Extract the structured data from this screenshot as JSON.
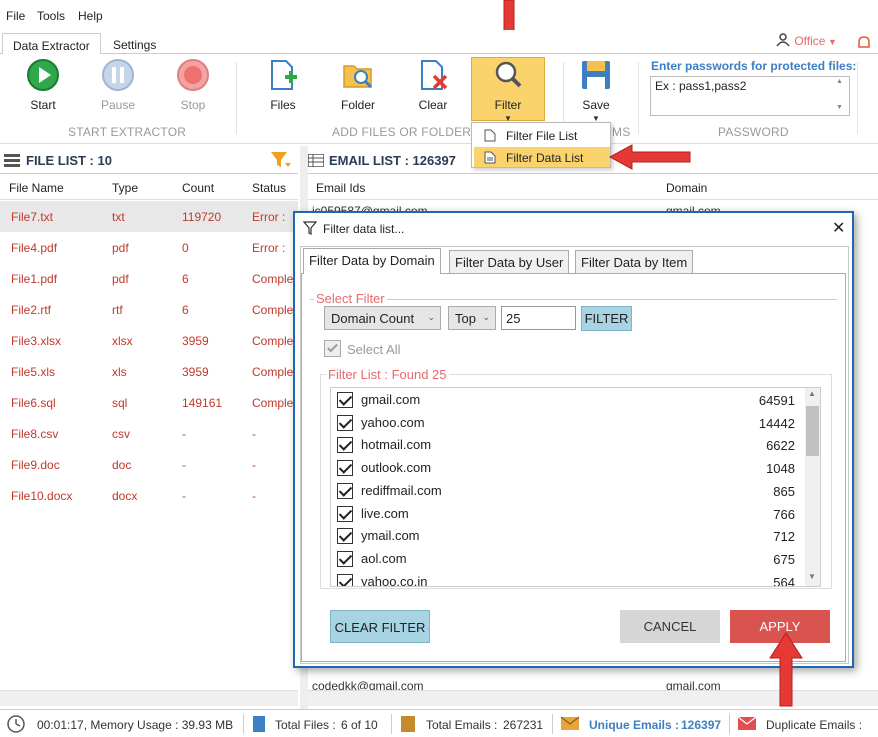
{
  "menu": {
    "file": "File",
    "tools": "Tools",
    "help": "Help"
  },
  "tabs": {
    "extractor": "Data Extractor",
    "settings": "Settings"
  },
  "office": "Office",
  "ribbon": {
    "start": "Start",
    "pause": "Pause",
    "stop": "Stop",
    "files": "Files",
    "folder": "Folder",
    "clear": "Clear",
    "filter": "Filter",
    "save": "Save",
    "grp_start": "START EXTRACTOR",
    "grp_add": "ADD FILES OR FOLDERS",
    "grp_ms": "MS",
    "grp_pw": "PASSWORD",
    "pw_label": "Enter passwords for protected files:",
    "pw_value": "Ex : pass1,pass2"
  },
  "dropdown": {
    "file_list": "Filter File List",
    "data_list": "Filter Data List"
  },
  "file_list": {
    "title": "FILE LIST : 10",
    "headers": [
      "File Name",
      "Type",
      "Count",
      "Status"
    ],
    "rows": [
      [
        "File7.txt",
        "txt",
        "119720",
        "Error :"
      ],
      [
        "File4.pdf",
        "pdf",
        "0",
        "Error :"
      ],
      [
        "File1.pdf",
        "pdf",
        "6",
        "Comple"
      ],
      [
        "File2.rtf",
        "rtf",
        "6",
        "Comple"
      ],
      [
        "File3.xlsx",
        "xlsx",
        "3959",
        "Comple"
      ],
      [
        "File5.xls",
        "xls",
        "3959",
        "Comple"
      ],
      [
        "File6.sql",
        "sql",
        "149161",
        "Comple"
      ],
      [
        "File8.csv",
        "csv",
        "-",
        "-"
      ],
      [
        "File9.doc",
        "doc",
        "-",
        "-"
      ],
      [
        "File10.docx",
        "docx",
        "-",
        "-"
      ]
    ]
  },
  "email_list": {
    "title": "EMAIL LIST : 126397",
    "headers": [
      "Email Ids",
      "Domain"
    ],
    "top_row": [
      "jc059587@gmail.com",
      "gmail.com"
    ],
    "bottom_row": [
      "codedkk@gmail.com",
      "gmail.com"
    ]
  },
  "dialog": {
    "title": "Filter data list...",
    "tabs": [
      "Filter Data by Domain",
      "Filter Data by User",
      "Filter Data by Item"
    ],
    "select_filter": "Select Filter",
    "sort_by": "Domain Count",
    "order": "Top",
    "count": "25",
    "filter_btn": "FILTER",
    "select_all": "Select All",
    "found": "Filter List : Found 25",
    "items": [
      {
        "name": "gmail.com",
        "count": "64591"
      },
      {
        "name": "yahoo.com",
        "count": "14442"
      },
      {
        "name": "hotmail.com",
        "count": "6622"
      },
      {
        "name": "outlook.com",
        "count": "1048"
      },
      {
        "name": "rediffmail.com",
        "count": "865"
      },
      {
        "name": "live.com",
        "count": "766"
      },
      {
        "name": "ymail.com",
        "count": "712"
      },
      {
        "name": "aol.com",
        "count": "675"
      },
      {
        "name": "yahoo.co.in",
        "count": "564"
      }
    ],
    "clear_btn": "CLEAR FILTER",
    "cancel_btn": "CANCEL",
    "apply_btn": "APPLY"
  },
  "status": {
    "time": "00:01:17, Memory Usage : 39.93 MB",
    "total_files_label": "Total Files :",
    "total_files": "6 of 10",
    "total_emails_label": "Total Emails :",
    "total_emails": "267231",
    "unique_label": "Unique Emails :",
    "unique": "126397",
    "dup_label": "Duplicate Emails :"
  },
  "colors": {
    "accent": "#3c7fc3",
    "apply": "#d9534f",
    "filter_btn": "#a8d3e3",
    "highlight": "#fbd36d",
    "error_text": "#c0392b"
  }
}
